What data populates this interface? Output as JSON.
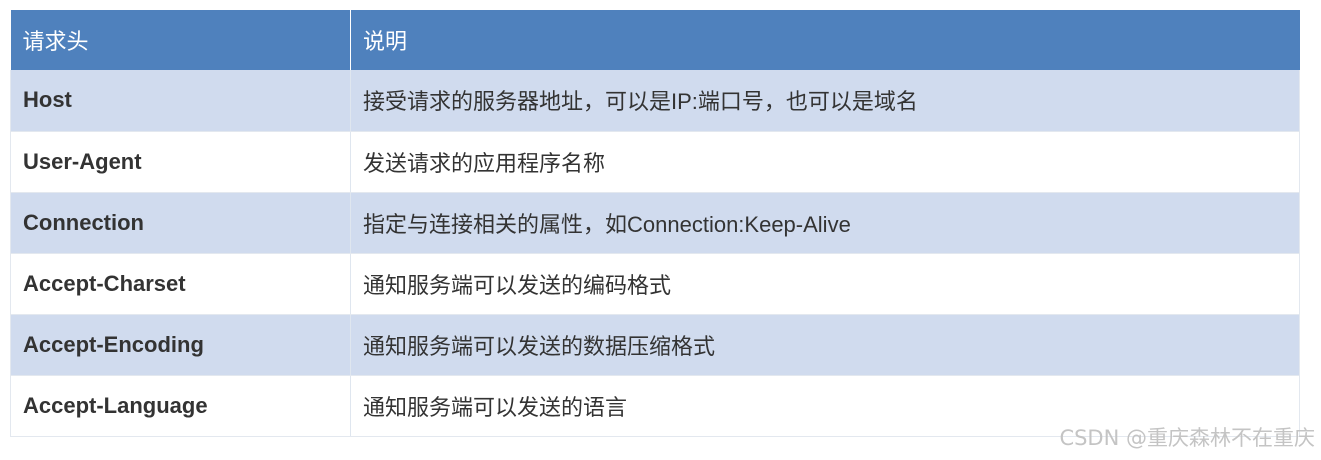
{
  "table": {
    "headers": [
      "请求头",
      "说明"
    ],
    "rows": [
      {
        "name": "Host",
        "desc": "接受请求的服务器地址，可以是IP:端口号，也可以是域名"
      },
      {
        "name": "User-Agent",
        "desc": "发送请求的应用程序名称"
      },
      {
        "name": "Connection",
        "desc": "指定与连接相关的属性，如Connection:Keep-Alive"
      },
      {
        "name": "Accept-Charset",
        "desc": "通知服务端可以发送的编码格式"
      },
      {
        "name": "Accept-Encoding",
        "desc": "通知服务端可以发送的数据压缩格式"
      },
      {
        "name": "Accept-Language",
        "desc": "通知服务端可以发送的语言"
      }
    ]
  },
  "watermark": "CSDN @重庆森林不在重庆",
  "colors": {
    "header_bg": "#4f81bd",
    "row_alt_bg": "#d0dbee",
    "row_bg": "#ffffff",
    "text": "#333333"
  }
}
